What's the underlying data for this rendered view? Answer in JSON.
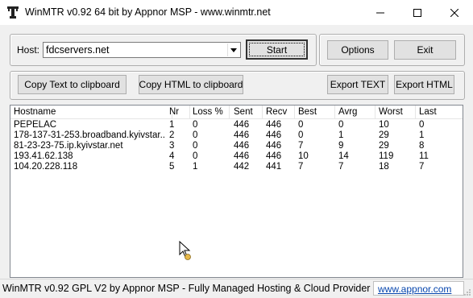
{
  "window": {
    "title": "WinMTR v0.92 64 bit by Appnor MSP - www.winmtr.net",
    "icon": "winmtr-app-icon",
    "controls": [
      "minimize-icon",
      "maximize-icon",
      "close-icon"
    ]
  },
  "host": {
    "label": "Host:",
    "value": "fdcservers.net",
    "dropdown_icon": "chevron-down-icon"
  },
  "buttons": {
    "start": "Start",
    "options": "Options",
    "exit": "Exit",
    "copy_text": "Copy Text to clipboard",
    "copy_html": "Copy HTML to clipboard",
    "export_text": "Export TEXT",
    "export_html": "Export HTML"
  },
  "table": {
    "columns": [
      "Hostname",
      "Nr",
      "Loss %",
      "Sent",
      "Recv",
      "Best",
      "Avrg",
      "Worst",
      "Last"
    ],
    "rows": [
      [
        "PEPELAC",
        "1",
        "0",
        "446",
        "446",
        "0",
        "0",
        "10",
        "0"
      ],
      [
        "178-137-31-253.broadband.kyivstar....",
        "2",
        "0",
        "446",
        "446",
        "0",
        "1",
        "29",
        "1"
      ],
      [
        "81-23-23-75.ip.kyivstar.net",
        "3",
        "0",
        "446",
        "446",
        "7",
        "9",
        "29",
        "8"
      ],
      [
        "193.41.62.138",
        "4",
        "0",
        "446",
        "446",
        "10",
        "14",
        "119",
        "11"
      ],
      [
        "104.20.228.118",
        "5",
        "1",
        "442",
        "441",
        "7",
        "7",
        "18",
        "7"
      ]
    ]
  },
  "statusbar": {
    "text": "WinMTR v0.92 GPL V2 by Appnor MSP - Fully Managed Hosting & Cloud Provider",
    "link": "www.appnor.com"
  },
  "colors": {
    "window_bg": "#f0f0f0",
    "button_bg": "#e1e1e1",
    "link": "#0645ad"
  }
}
